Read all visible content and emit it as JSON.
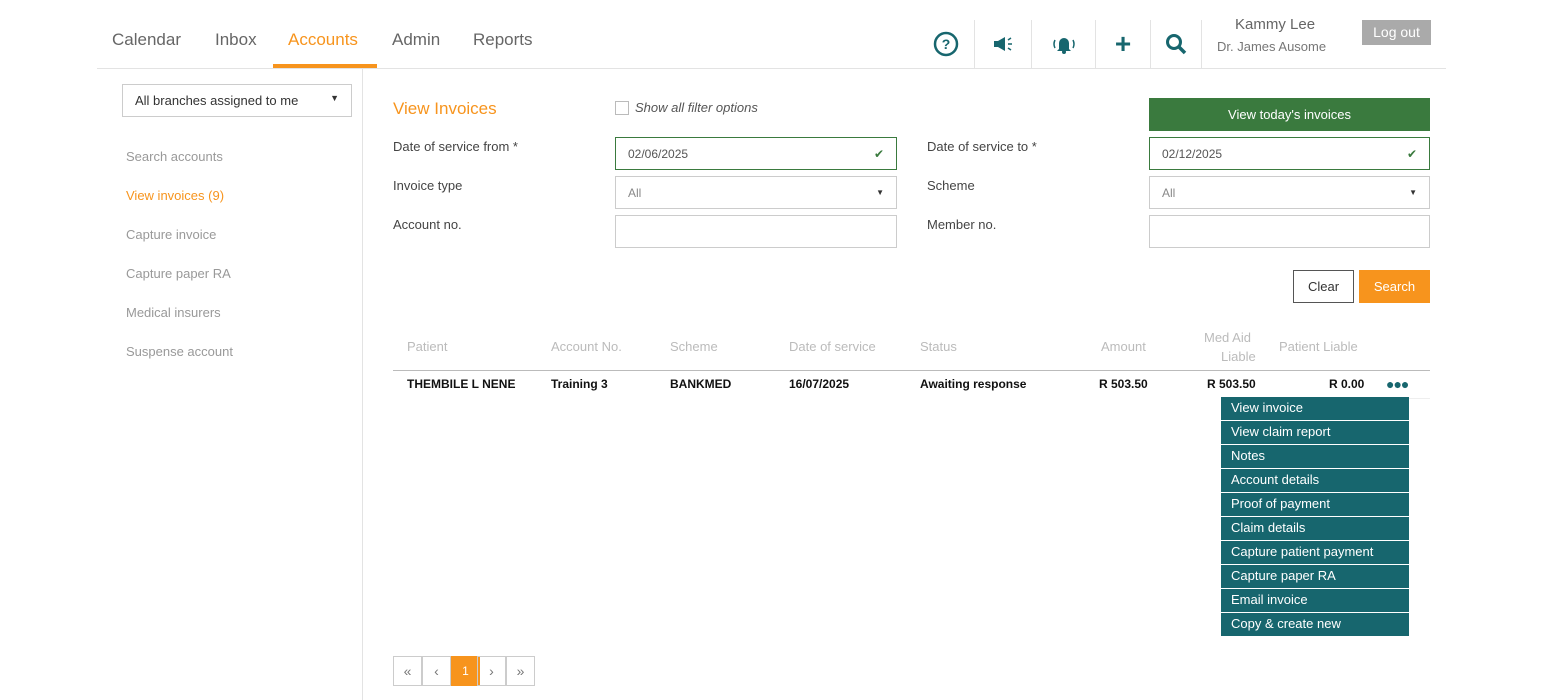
{
  "nav": {
    "tabs": [
      "Calendar",
      "Inbox",
      "Accounts",
      "Admin",
      "Reports"
    ],
    "active": "Accounts"
  },
  "user": {
    "name": "Kammy Lee",
    "practice": "Dr. James Ausome",
    "logout": "Log out"
  },
  "sidebar": {
    "branch": "All branches assigned to me",
    "items": [
      "Search accounts",
      "View invoices (9)",
      "Capture invoice",
      "Capture paper RA",
      "Medical insurers",
      "Suspense account"
    ]
  },
  "form": {
    "title": "View Invoices",
    "show_all": "Show all filter options",
    "today_btn": "View today's invoices",
    "date_from_label": "Date of service from *",
    "date_from": "02/06/2025",
    "date_to_label": "Date of service to *",
    "date_to": "02/12/2025",
    "invoice_type_label": "Invoice type",
    "invoice_type": "All",
    "scheme_label": "Scheme",
    "scheme": "All",
    "account_label": "Account no.",
    "member_label": "Member no.",
    "clear": "Clear",
    "search": "Search"
  },
  "table": {
    "headers": [
      "Patient",
      "Account No.",
      "Scheme",
      "Date of service",
      "Status",
      "Amount",
      "Med Aid",
      "Liable",
      "Patient Liable"
    ],
    "rows": [
      {
        "patient": "THEMBILE L NENE",
        "account": "Training 3",
        "scheme": "BANKMED",
        "date": "16/07/2025",
        "status": "Awaiting response",
        "amount": "R 503.50",
        "med_aid": "R 503.50",
        "patient_liable": "R 0.00"
      }
    ]
  },
  "menu": [
    "View invoice",
    "View claim report",
    "Notes",
    "Account details",
    "Proof of payment",
    "Claim details",
    "Capture patient payment",
    "Capture paper RA",
    "Email invoice",
    "Copy & create new"
  ],
  "pagination": {
    "first": "«",
    "prev": "‹",
    "current": "1",
    "next": "›",
    "last": "»"
  }
}
